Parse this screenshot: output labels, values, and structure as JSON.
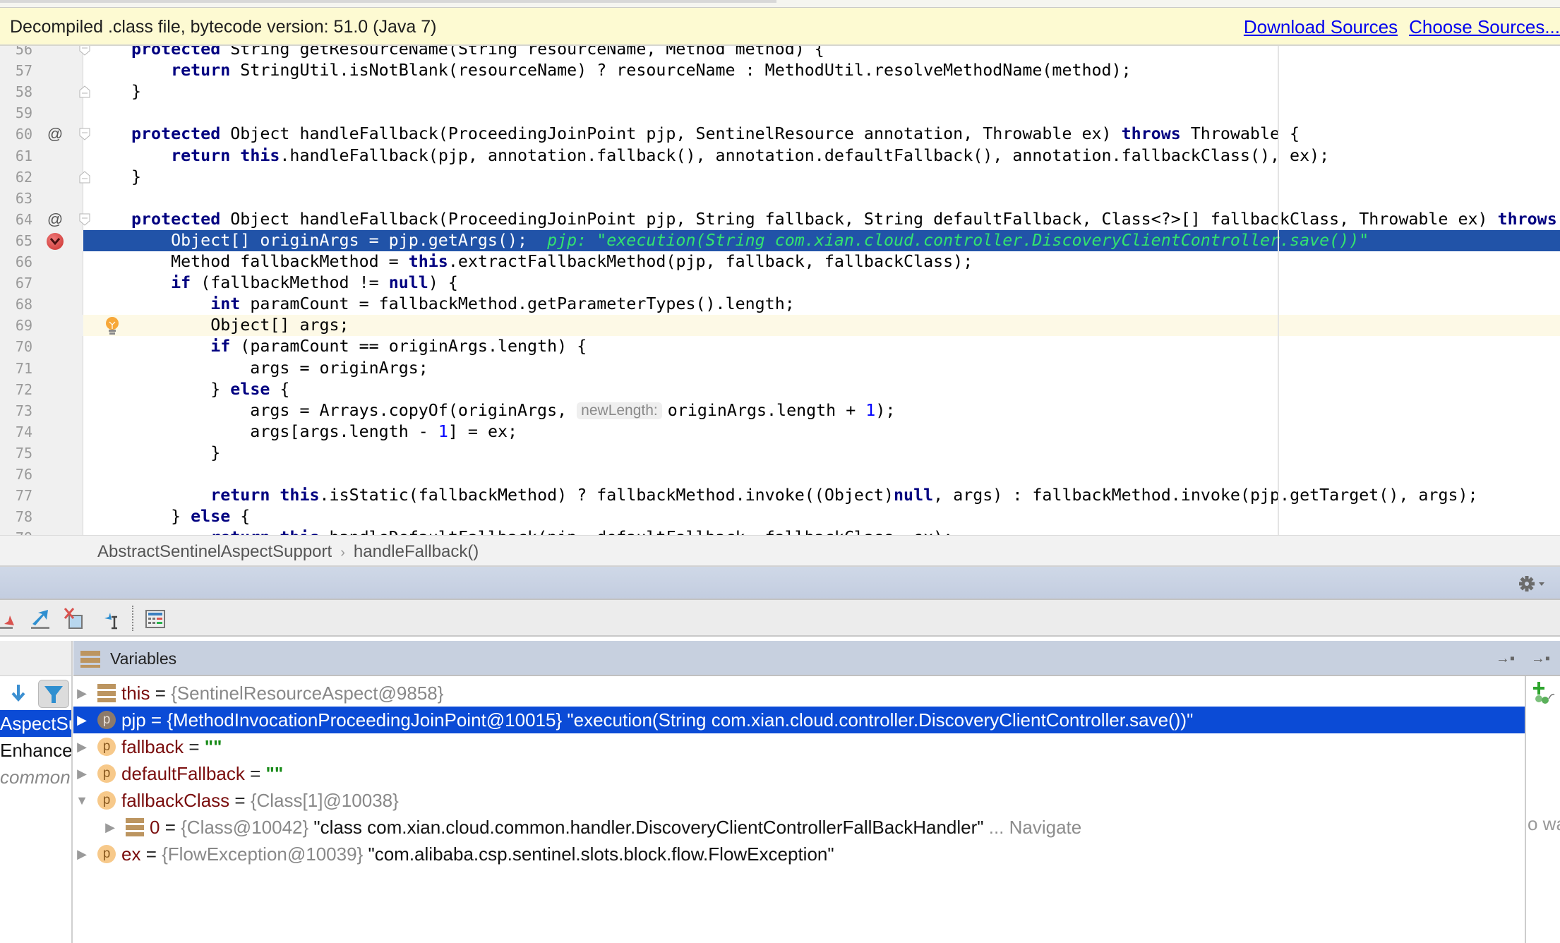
{
  "banner": {
    "message": "Decompiled .class file, bytecode version: 51.0 (Java 7)",
    "links": [
      "Download Sources",
      "Choose Sources..."
    ]
  },
  "editor": {
    "lines": [
      {
        "num": "56",
        "marker": "",
        "fold": "open",
        "html": "<span class=\"kw\">protected</span> String getResourceName(String resourceName, Method method) {"
      },
      {
        "num": "57",
        "marker": "",
        "fold": "",
        "html": "    <span class=\"kw\">return</span> StringUtil.isNotBlank(resourceName) ? resourceName : MethodUtil.resolveMethodName(method);"
      },
      {
        "num": "58",
        "marker": "",
        "fold": "close",
        "html": "}"
      },
      {
        "num": "59",
        "marker": "",
        "fold": "",
        "html": ""
      },
      {
        "num": "60",
        "marker": "@",
        "fold": "open",
        "html": "<span class=\"kw\">protected</span> Object handleFallback(ProceedingJoinPoint pjp, SentinelResource annotation, Throwable ex) <span class=\"kw\">throws</span> Throwable {"
      },
      {
        "num": "61",
        "marker": "",
        "fold": "",
        "html": "    <span class=\"kw\">return this</span>.handleFallback(pjp, annotation.fallback(), annotation.defaultFallback(), annotation.fallbackClass(), ex);"
      },
      {
        "num": "62",
        "marker": "",
        "fold": "close",
        "html": "}"
      },
      {
        "num": "63",
        "marker": "",
        "fold": "",
        "html": ""
      },
      {
        "num": "64",
        "marker": "@",
        "fold": "open",
        "html": "<span class=\"kw\">protected</span> Object handleFallback(ProceedingJoinPoint pjp, String fallback, String defaultFallback, Class&lt;?&gt;[] fallbackClass, Throwable ex) <span class=\"kw\">throws</span>"
      },
      {
        "num": "65",
        "marker": "breakpoint",
        "fold": "",
        "state": "exec",
        "html": "    Object[] originArgs = pjp.getArgs();  <span class=\"inline-val\">pjp: \"execution(String com.xian.cloud.controller.DiscoveryClientController.save())\"</span>"
      },
      {
        "num": "66",
        "marker": "",
        "fold": "",
        "html": "    Method fallbackMethod = <span class=\"kw\">this</span>.extractFallbackMethod(pjp, fallback, fallbackClass);"
      },
      {
        "num": "67",
        "marker": "",
        "fold": "",
        "html": "    <span class=\"kw\">if</span> (fallbackMethod != <span class=\"kw\">null</span>) {"
      },
      {
        "num": "68",
        "marker": "",
        "fold": "",
        "html": "        <span class=\"kw\">int</span> paramCount = fallbackMethod.getParameterTypes().length;"
      },
      {
        "num": "69",
        "marker": "bulb",
        "fold": "",
        "state": "caret",
        "html": "        Object[] args;"
      },
      {
        "num": "70",
        "marker": "",
        "fold": "",
        "html": "        <span class=\"kw\">if</span> (paramCount == originArgs.length) {"
      },
      {
        "num": "71",
        "marker": "",
        "fold": "",
        "html": "            args = originArgs;"
      },
      {
        "num": "72",
        "marker": "",
        "fold": "",
        "html": "        } <span class=\"kw\">else</span> {"
      },
      {
        "num": "73",
        "marker": "",
        "fold": "",
        "html": "            args = Arrays.copyOf(originArgs, <span class=\"hint\">newLength:</span>originArgs.length + <span class=\"num\">1</span>);"
      },
      {
        "num": "74",
        "marker": "",
        "fold": "",
        "html": "            args[args.length - <span class=\"num\">1</span>] = ex;"
      },
      {
        "num": "75",
        "marker": "",
        "fold": "",
        "html": "        }"
      },
      {
        "num": "76",
        "marker": "",
        "fold": "",
        "html": ""
      },
      {
        "num": "77",
        "marker": "",
        "fold": "",
        "html": "        <span class=\"kw\">return this</span>.isStatic(fallbackMethod) ? fallbackMethod.invoke((Object)<span class=\"kw\">null</span>, args) : fallbackMethod.invoke(pjp.getTarget(), args);"
      },
      {
        "num": "78",
        "marker": "",
        "fold": "",
        "html": "    } <span class=\"kw\">else</span> {"
      },
      {
        "num": "79",
        "marker": "",
        "fold": "",
        "html": "        <span class=\"kw\">return this</span>.handleDefaultFallback(pjp, defaultFallback, fallbackClass, ex);"
      }
    ]
  },
  "breadcrumb": {
    "items": [
      "AbstractSentinelAspectSupport",
      "handleFallback()"
    ]
  },
  "debugger": {
    "variables_title": "Variables",
    "frames": [
      {
        "label": "AspectSu",
        "state": "selected"
      },
      {
        "label": "Enhancer",
        "state": "normal"
      },
      {
        "label": "common",
        "state": "library"
      }
    ],
    "variables": [
      {
        "expander": "collapsed",
        "indent": 0,
        "icon": "field",
        "name": "this",
        "type": "{SentinelResourceAspect@9858}",
        "value": "",
        "selected": false
      },
      {
        "expander": "collapsed",
        "indent": 0,
        "icon": "param",
        "name": "pjp",
        "type": "{MethodInvocationProceedingJoinPoint@10015}",
        "value": "\"execution(String com.xian.cloud.controller.DiscoveryClientController.save())\"",
        "selected": true
      },
      {
        "expander": "collapsed",
        "indent": 0,
        "icon": "param",
        "name": "fallback",
        "type": "",
        "string": "\"\"",
        "selected": false
      },
      {
        "expander": "collapsed",
        "indent": 0,
        "icon": "param",
        "name": "defaultFallback",
        "type": "",
        "string": "\"\"",
        "selected": false
      },
      {
        "expander": "expanded",
        "indent": 0,
        "icon": "param",
        "name": "fallbackClass",
        "type": "{Class[1]@10038}",
        "value": "",
        "selected": false
      },
      {
        "expander": "collapsed",
        "indent": 1,
        "icon": "field",
        "name": "0",
        "type": "{Class@10042}",
        "value": "\"class com.xian.cloud.common.handler.DiscoveryClientControllerFallBackHandler\"",
        "navigate": "... Navigate",
        "selected": false
      },
      {
        "expander": "collapsed",
        "indent": 0,
        "icon": "param",
        "name": "ex",
        "type": "{FlowException@10039}",
        "value": "\"com.alibaba.csp.sentinel.slots.block.flow.FlowException\"",
        "selected": false
      }
    ],
    "clipped_hint": "o wa"
  }
}
